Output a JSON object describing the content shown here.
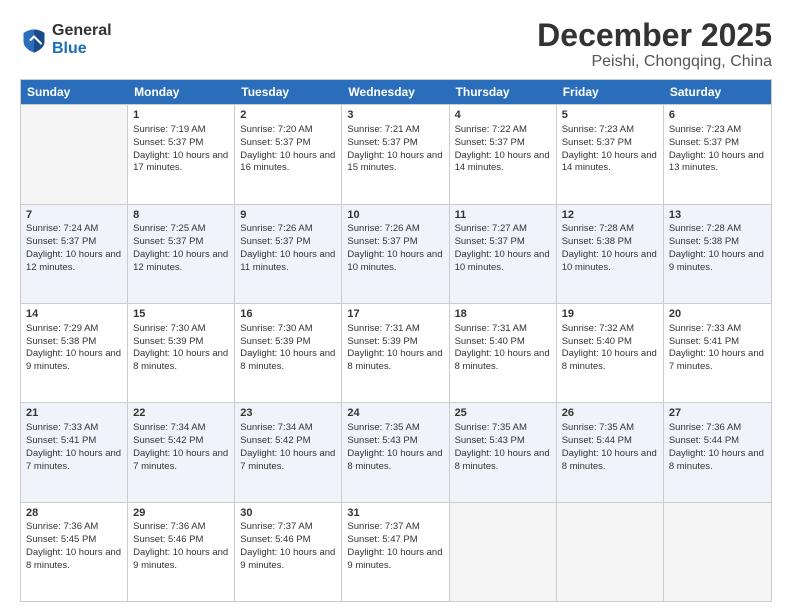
{
  "logo": {
    "general": "General",
    "blue": "Blue"
  },
  "header": {
    "month": "December 2025",
    "location": "Peishi, Chongqing, China"
  },
  "weekdays": [
    "Sunday",
    "Monday",
    "Tuesday",
    "Wednesday",
    "Thursday",
    "Friday",
    "Saturday"
  ],
  "rows": [
    [
      {
        "day": "",
        "empty": true
      },
      {
        "day": "1",
        "sunrise": "7:19 AM",
        "sunset": "5:37 PM",
        "daylight": "10 hours and 17 minutes."
      },
      {
        "day": "2",
        "sunrise": "7:20 AM",
        "sunset": "5:37 PM",
        "daylight": "10 hours and 16 minutes."
      },
      {
        "day": "3",
        "sunrise": "7:21 AM",
        "sunset": "5:37 PM",
        "daylight": "10 hours and 15 minutes."
      },
      {
        "day": "4",
        "sunrise": "7:22 AM",
        "sunset": "5:37 PM",
        "daylight": "10 hours and 14 minutes."
      },
      {
        "day": "5",
        "sunrise": "7:23 AM",
        "sunset": "5:37 PM",
        "daylight": "10 hours and 14 minutes."
      },
      {
        "day": "6",
        "sunrise": "7:23 AM",
        "sunset": "5:37 PM",
        "daylight": "10 hours and 13 minutes."
      }
    ],
    [
      {
        "day": "7",
        "sunrise": "7:24 AM",
        "sunset": "5:37 PM",
        "daylight": "10 hours and 12 minutes."
      },
      {
        "day": "8",
        "sunrise": "7:25 AM",
        "sunset": "5:37 PM",
        "daylight": "10 hours and 12 minutes."
      },
      {
        "day": "9",
        "sunrise": "7:26 AM",
        "sunset": "5:37 PM",
        "daylight": "10 hours and 11 minutes."
      },
      {
        "day": "10",
        "sunrise": "7:26 AM",
        "sunset": "5:37 PM",
        "daylight": "10 hours and 10 minutes."
      },
      {
        "day": "11",
        "sunrise": "7:27 AM",
        "sunset": "5:37 PM",
        "daylight": "10 hours and 10 minutes."
      },
      {
        "day": "12",
        "sunrise": "7:28 AM",
        "sunset": "5:38 PM",
        "daylight": "10 hours and 10 minutes."
      },
      {
        "day": "13",
        "sunrise": "7:28 AM",
        "sunset": "5:38 PM",
        "daylight": "10 hours and 9 minutes."
      }
    ],
    [
      {
        "day": "14",
        "sunrise": "7:29 AM",
        "sunset": "5:38 PM",
        "daylight": "10 hours and 9 minutes."
      },
      {
        "day": "15",
        "sunrise": "7:30 AM",
        "sunset": "5:39 PM",
        "daylight": "10 hours and 8 minutes."
      },
      {
        "day": "16",
        "sunrise": "7:30 AM",
        "sunset": "5:39 PM",
        "daylight": "10 hours and 8 minutes."
      },
      {
        "day": "17",
        "sunrise": "7:31 AM",
        "sunset": "5:39 PM",
        "daylight": "10 hours and 8 minutes."
      },
      {
        "day": "18",
        "sunrise": "7:31 AM",
        "sunset": "5:40 PM",
        "daylight": "10 hours and 8 minutes."
      },
      {
        "day": "19",
        "sunrise": "7:32 AM",
        "sunset": "5:40 PM",
        "daylight": "10 hours and 8 minutes."
      },
      {
        "day": "20",
        "sunrise": "7:33 AM",
        "sunset": "5:41 PM",
        "daylight": "10 hours and 7 minutes."
      }
    ],
    [
      {
        "day": "21",
        "sunrise": "7:33 AM",
        "sunset": "5:41 PM",
        "daylight": "10 hours and 7 minutes."
      },
      {
        "day": "22",
        "sunrise": "7:34 AM",
        "sunset": "5:42 PM",
        "daylight": "10 hours and 7 minutes."
      },
      {
        "day": "23",
        "sunrise": "7:34 AM",
        "sunset": "5:42 PM",
        "daylight": "10 hours and 7 minutes."
      },
      {
        "day": "24",
        "sunrise": "7:35 AM",
        "sunset": "5:43 PM",
        "daylight": "10 hours and 8 minutes."
      },
      {
        "day": "25",
        "sunrise": "7:35 AM",
        "sunset": "5:43 PM",
        "daylight": "10 hours and 8 minutes."
      },
      {
        "day": "26",
        "sunrise": "7:35 AM",
        "sunset": "5:44 PM",
        "daylight": "10 hours and 8 minutes."
      },
      {
        "day": "27",
        "sunrise": "7:36 AM",
        "sunset": "5:44 PM",
        "daylight": "10 hours and 8 minutes."
      }
    ],
    [
      {
        "day": "28",
        "sunrise": "7:36 AM",
        "sunset": "5:45 PM",
        "daylight": "10 hours and 8 minutes."
      },
      {
        "day": "29",
        "sunrise": "7:36 AM",
        "sunset": "5:46 PM",
        "daylight": "10 hours and 9 minutes."
      },
      {
        "day": "30",
        "sunrise": "7:37 AM",
        "sunset": "5:46 PM",
        "daylight": "10 hours and 9 minutes."
      },
      {
        "day": "31",
        "sunrise": "7:37 AM",
        "sunset": "5:47 PM",
        "daylight": "10 hours and 9 minutes."
      },
      {
        "day": "",
        "empty": true
      },
      {
        "day": "",
        "empty": true
      },
      {
        "day": "",
        "empty": true
      }
    ]
  ]
}
